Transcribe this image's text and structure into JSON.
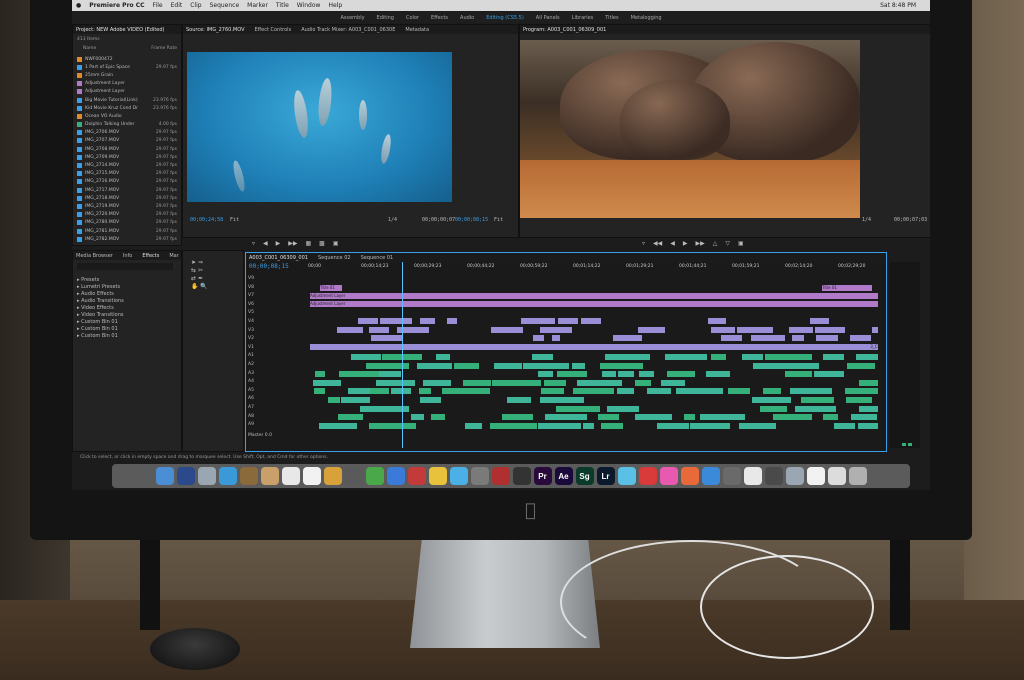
{
  "menubar": {
    "app": "Premiere Pro CC",
    "items": [
      "File",
      "Edit",
      "Clip",
      "Sequence",
      "Marker",
      "Title",
      "Window",
      "Help"
    ],
    "clock": "Sat 8:48 PM"
  },
  "workspaces": {
    "items": [
      "Assembly",
      "Editing",
      "Color",
      "Effects",
      "Audio",
      "Editing (CS5.5)",
      "All Panels",
      "Libraries",
      "Titles",
      "Metalogging"
    ],
    "active": "Editing (CS5.5)"
  },
  "project_panel": {
    "title": "Project: NEW Adobe VIDEO (Edited)",
    "item_count": "413 Items",
    "col_name": "Name",
    "col_fps": "Frame Rate",
    "rows": [
      {
        "name": "NWF000472",
        "fps": "",
        "color": "#e08a2b"
      },
      {
        "name": "1 Part of Epic Space",
        "fps": "29.97 fps",
        "color": "#3aa0e6"
      },
      {
        "name": "25mm Grain",
        "fps": "",
        "color": "#e08a2b"
      },
      {
        "name": "Adjustment Layer",
        "fps": "",
        "color": "#b07ac9"
      },
      {
        "name": "Adjustment Layer",
        "fps": "",
        "color": "#b07ac9"
      },
      {
        "name": "Big Movie Tutorial(Link)",
        "fps": "23.976 fps",
        "color": "#3aa0e6"
      },
      {
        "name": "Kid Movie Kruz Cond Dr",
        "fps": "23.976 fps",
        "color": "#3aa0e6"
      },
      {
        "name": "Ocean VO Audio",
        "fps": "",
        "color": "#e08a2b"
      },
      {
        "name": "Dolphin Talking Under",
        "fps": "4.00 fps",
        "color": "#36b07a"
      },
      {
        "name": "IMG_2706.MOV",
        "fps": "29.97 fps",
        "color": "#3aa0e6"
      },
      {
        "name": "IMG_2707.MOV",
        "fps": "29.97 fps",
        "color": "#3aa0e6"
      },
      {
        "name": "IMG_2708.MOV",
        "fps": "29.97 fps",
        "color": "#3aa0e6"
      },
      {
        "name": "IMG_2709.MOV",
        "fps": "29.97 fps",
        "color": "#3aa0e6"
      },
      {
        "name": "IMG_2714.MOV",
        "fps": "29.97 fps",
        "color": "#3aa0e6"
      },
      {
        "name": "IMG_2715.MOV",
        "fps": "29.97 fps",
        "color": "#3aa0e6"
      },
      {
        "name": "IMG_2716.MOV",
        "fps": "29.97 fps",
        "color": "#3aa0e6"
      },
      {
        "name": "IMG_2717.MOV",
        "fps": "29.97 fps",
        "color": "#3aa0e6"
      },
      {
        "name": "IMG_2718.MOV",
        "fps": "29.97 fps",
        "color": "#3aa0e6"
      },
      {
        "name": "IMG_2719.MOV",
        "fps": "29.97 fps",
        "color": "#3aa0e6"
      },
      {
        "name": "IMG_2720.MOV",
        "fps": "29.97 fps",
        "color": "#3aa0e6"
      },
      {
        "name": "IMG_2780.MOV",
        "fps": "29.97 fps",
        "color": "#3aa0e6"
      },
      {
        "name": "IMG_2781.MOV",
        "fps": "29.97 fps",
        "color": "#3aa0e6"
      },
      {
        "name": "IMG_2782.MOV",
        "fps": "29.97 fps",
        "color": "#3aa0e6"
      }
    ]
  },
  "source_monitor": {
    "tabs": [
      "Source: IMG_2760.MOV",
      "Effect Controls",
      "Audio Track Mixer: A003_C001_0630E",
      "Metadata"
    ],
    "timecode_left": "00;00;24;58",
    "fit": "Fit",
    "scale": "1/4",
    "timecode_right": "00;00;00;07"
  },
  "program_monitor": {
    "title": "Program: A003_C001_06309_001",
    "timecode_left": "00;00;08;15",
    "fit": "Fit",
    "scale": "1/4",
    "timecode_right": "00;00;07;03"
  },
  "effects_panel": {
    "tabs": [
      "Media Browser",
      "Info",
      "Effects",
      "Mar"
    ],
    "items": [
      "Presets",
      "Lumetri Presets",
      "Audio Effects",
      "Audio Transitions",
      "Video Effects",
      "Video Transitions",
      "Custom Bin 01",
      "Custom Bin 01",
      "Custom Bin 01"
    ]
  },
  "timeline": {
    "tabs": [
      "A003_C001_06309_001",
      "Sequence 02",
      "Sequence 01"
    ],
    "timecode": "00;00;08;15",
    "ruler": [
      "00;00",
      "00;00;14;23",
      "00;00;29;23",
      "00;00;44;22",
      "00;00;59;22",
      "00;01;14;22",
      "00;01;29;21",
      "00;01;44;21",
      "00;01;59;21",
      "00;02;14;20",
      "00;02;29;20"
    ],
    "video_tracks": [
      "V9",
      "V8",
      "V7",
      "V6",
      "V5",
      "V4",
      "V3",
      "V2",
      "V1"
    ],
    "audio_tracks": [
      "A1",
      "A2",
      "A3",
      "A4",
      "A5",
      "A6",
      "A7",
      "A8",
      "A9"
    ],
    "master_label": "Master",
    "master_value": "0.0",
    "labels": {
      "adj1": "Adjustment Layer",
      "adj2": "Adjustment Layer",
      "title": "Title 01",
      "clipA": "A003_C001_0",
      "clipB": "A003_C001_06309_001"
    }
  },
  "status_bar": "Click to select, or click in empty space and drag to marquee select. Use Shift, Opt, and Cmd for other options.",
  "dock": {
    "apps": [
      {
        "label": "",
        "color": "#4a8fd6"
      },
      {
        "label": "",
        "color": "#2b4a8c"
      },
      {
        "label": "",
        "color": "#9aa7b3"
      },
      {
        "label": "",
        "color": "#3a9ad9"
      },
      {
        "label": "",
        "color": "#8a6a3a"
      },
      {
        "label": "",
        "color": "#c9a06a"
      },
      {
        "label": "",
        "color": "#e8e8e8"
      },
      {
        "label": "",
        "color": "#f2f2f2"
      },
      {
        "label": "",
        "color": "#d9a13a"
      },
      {
        "label": "",
        "color": "#5a5a5a"
      },
      {
        "label": "",
        "color": "#4aa84a"
      },
      {
        "label": "",
        "color": "#3a7ad9"
      },
      {
        "label": "",
        "color": "#c23a3a"
      },
      {
        "label": "",
        "color": "#e8c23a"
      },
      {
        "label": "",
        "color": "#4ab0e6"
      },
      {
        "label": "",
        "color": "#7a7a7a"
      },
      {
        "label": "",
        "color": "#b03030"
      },
      {
        "label": "",
        "color": "#333333"
      },
      {
        "label": "Pr",
        "color": "#2a0a3a"
      },
      {
        "label": "Ae",
        "color": "#1a0a3a"
      },
      {
        "label": "Sg",
        "color": "#0a3a2a"
      },
      {
        "label": "Lr",
        "color": "#0a1a2a"
      },
      {
        "label": "",
        "color": "#5ac0e6"
      },
      {
        "label": "",
        "color": "#d93a3a"
      },
      {
        "label": "",
        "color": "#e85ab0"
      },
      {
        "label": "",
        "color": "#e86a3a"
      },
      {
        "label": "",
        "color": "#3a8ad9"
      },
      {
        "label": "",
        "color": "#6a6a6a"
      },
      {
        "label": "",
        "color": "#e8e8e8"
      },
      {
        "label": "",
        "color": "#4a4a4a"
      },
      {
        "label": "",
        "color": "#9aa7b3"
      },
      {
        "label": "",
        "color": "#f2f2f2"
      },
      {
        "label": "",
        "color": "#dcdcdc"
      },
      {
        "label": "",
        "color": "#b0b0b0"
      }
    ]
  },
  "colors": {
    "accent": "#3aa0e6",
    "video_clip": "#b07ac9",
    "graphics_clip": "#9a8ed6",
    "audio_clip": "#36b07a"
  }
}
